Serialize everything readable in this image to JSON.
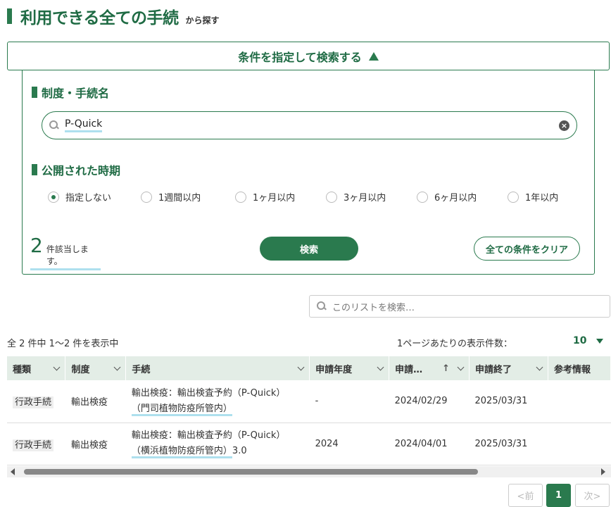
{
  "header": {
    "title": "利用できる全ての手続",
    "subtitle": "から探す"
  },
  "conditions": {
    "toggle_label": "条件を指定して検索する",
    "name_section_title": "制度・手続名",
    "name_search_value": "P-Quick",
    "period_section_title": "公開された時期",
    "period_options": [
      "指定しない",
      "1週間以内",
      "1ヶ月以内",
      "3ヶ月以内",
      "6ヶ月以内",
      "1年以内"
    ],
    "period_selected": "指定しない",
    "hit_count": "2",
    "hit_label": "件該当します。",
    "search_button": "検索",
    "clear_button": "全ての条件をクリア"
  },
  "list": {
    "search_placeholder": "このリストを検索…",
    "summary": "全 2 件中 1～2 件を表示中",
    "per_page_label": "1ページあたりの表示件数：",
    "per_page_value": "10",
    "columns": [
      "種類",
      "制度",
      "手続",
      "申請年度",
      "申請…",
      "申請終了",
      "参考情報"
    ],
    "rows": [
      {
        "kind": "行政手続",
        "system": "輸出検疫",
        "procedure_line1": "輸出検疫：輸出検査予約（P-Quick）",
        "procedure_line2": "（門司植物防疫所管内）",
        "procedure_suffix": "",
        "fiscal_year": "-",
        "start": "2024/02/29",
        "end": "2025/03/31",
        "reference": ""
      },
      {
        "kind": "行政手続",
        "system": "輸出検疫",
        "procedure_line1": "輸出検疫：輸出検査予約（P-Quick）",
        "procedure_line2": "（横浜植物防疫所管内）",
        "procedure_suffix": "3.0",
        "fiscal_year": "2024",
        "start": "2024/04/01",
        "end": "2025/03/31",
        "reference": ""
      }
    ]
  },
  "pagination": {
    "prev": "<前",
    "current": "1",
    "next": "次>"
  },
  "colors": {
    "brand_green": "#2a7a4e",
    "highlight_underline": "#aee0ee"
  }
}
